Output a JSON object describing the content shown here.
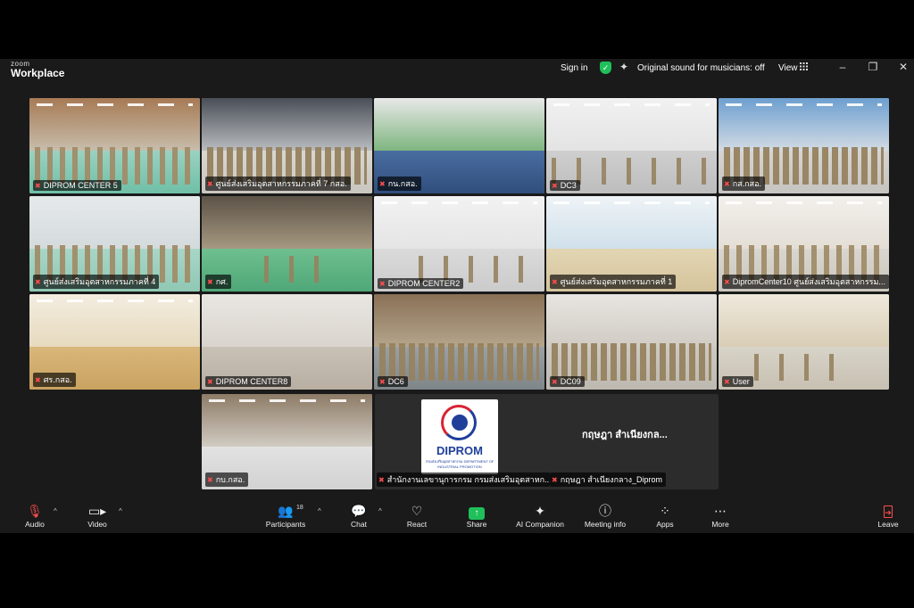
{
  "app": {
    "brand_top": "zoom",
    "brand_main": "Workplace"
  },
  "titlebar": {
    "sign_in": "Sign in",
    "original_sound": "Original sound for musicians: off",
    "view": "View",
    "controls": {
      "minimize": "–",
      "restore": "❐",
      "close": "✕"
    }
  },
  "tiles": [
    {
      "name": "DIPROM CENTER 5"
    },
    {
      "name": "ศูนย์ส่งเสริมอุตสาหกรรมภาคที่ 7 กสอ."
    },
    {
      "name": "กน.กสอ."
    },
    {
      "name": "DC3"
    },
    {
      "name": "กส.กสอ."
    },
    {
      "name": "ศูนย์ส่งเสริมอุตสาหกรรมภาคที่ 4"
    },
    {
      "name": "กศ."
    },
    {
      "name": "DIPROM CENTER2"
    },
    {
      "name": "ศูนย์ส่งเสริมอุตสาหกรรมภาคที่ 1"
    },
    {
      "name": "DipromCenter10 ศูนย์ส่งเสริมอุตสาหกรรม..."
    },
    {
      "name": "ศร.กสอ."
    },
    {
      "name": "DIPROM CENTER8"
    },
    {
      "name": "DC6"
    },
    {
      "name": "DC09"
    },
    {
      "name": "User"
    },
    {
      "name": "กบ.กสอ."
    }
  ],
  "dark_tile": {
    "left_label": "สำนักงานเลขานุการกรม กรมส่งเสริมอุตสาหก...",
    "right_label": "กฤษฎา สำเนียงกลาง_Diprom",
    "display_name": "กฤษฎา สำเนียงกล...",
    "logo_text": "DIPROM",
    "logo_sub": "กรมส่งเสริมอุตสาหกรรม DEPARTMENT OF INDUSTRIAL PROMOTION"
  },
  "toolbar": {
    "audio": "Audio",
    "video": "Video",
    "participants": "Participants",
    "participants_count": "18",
    "chat": "Chat",
    "react": "React",
    "share": "Share",
    "ai_companion": "AI Companion",
    "meeting_info": "Meeting info",
    "apps": "Apps",
    "more": "More",
    "leave": "Leave"
  },
  "colors": {
    "active_speaker": "#3fd36a",
    "share": "#1fbf5a",
    "leave": "#ff4d4d",
    "muted": "#ff4d4d"
  }
}
